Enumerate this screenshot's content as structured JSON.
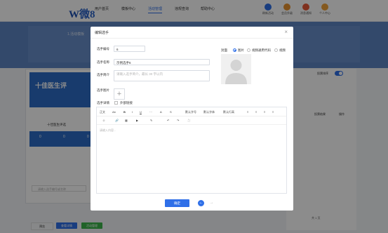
{
  "topnav": {
    "logo": "微8",
    "menu": [
      "用户首页",
      "模板中心",
      "活动管理",
      "违规查询",
      "帮助中心"
    ],
    "active_index": 2,
    "right": [
      "刷新活动",
      "会员升级",
      "消息通知",
      "个人中心"
    ]
  },
  "background": {
    "banner_title": "1.活动模板",
    "phone_title": "十佳医生评",
    "vote_title": "十佳医生评选",
    "stats": [
      "0",
      "0",
      "0"
    ],
    "search_placeholder": "请输入选手编号或名称",
    "right_toggle_label": "投票排序",
    "buttons": [
      "预览",
      "查看详情",
      "活动管理"
    ],
    "right_col_headers": [
      "投票结果",
      "操作"
    ],
    "pagination": "共 1 页"
  },
  "modal": {
    "title": "编辑选手",
    "close": "×",
    "fields": {
      "number_label": "选手编号",
      "number_value": "6",
      "name_label": "选手名称",
      "name_value": "示例选手6",
      "desc_label": "选手简介",
      "desc_placeholder": "请输入选手简介，最长 30 字以内",
      "image_label": "选手图片",
      "plus": "+",
      "detail_label": "选手详情",
      "link_label": "外部链接"
    },
    "cover": {
      "label": "封面",
      "options": [
        "图片",
        "视频通用代码",
        "视频"
      ],
      "selected_index": 0
    },
    "editor": {
      "toolbar_row1": [
        "正文",
        "B",
        "I",
        "U",
        "S",
        "A",
        "Ab",
        "默认字号",
        "默认字体",
        "默认行高",
        "≡",
        "≡",
        "≡",
        "≡"
      ],
      "toolbar_row2": [
        "☺",
        "🔗",
        "▦",
        "▶",
        "✎",
        "↶",
        "↷",
        "⛶"
      ],
      "placeholder": "请输入内容..."
    },
    "ok_button": "确定",
    "prev_icon": "←",
    "next_icon": "→"
  }
}
